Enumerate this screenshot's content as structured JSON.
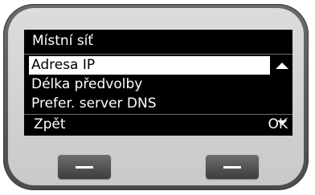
{
  "screen": {
    "title": "Místní síť",
    "menu_items": [
      {
        "label": "Adresa IP",
        "selected": true
      },
      {
        "label": "Délka předvolby",
        "selected": false
      },
      {
        "label": "Prefer. server DNS",
        "selected": false
      }
    ],
    "scroll_up_icon": "arrow-up-icon",
    "scroll_down_icon": "arrow-down-icon",
    "softkeys": {
      "left_label": "Zpět",
      "right_label": "OK"
    }
  },
  "hardware_keys": {
    "left_icon": "dash-icon",
    "right_icon": "dash-icon"
  },
  "colors": {
    "screen_background": "#000000",
    "screen_text": "#ffffff",
    "selection_background": "#ffffff",
    "selection_text": "#000000"
  }
}
